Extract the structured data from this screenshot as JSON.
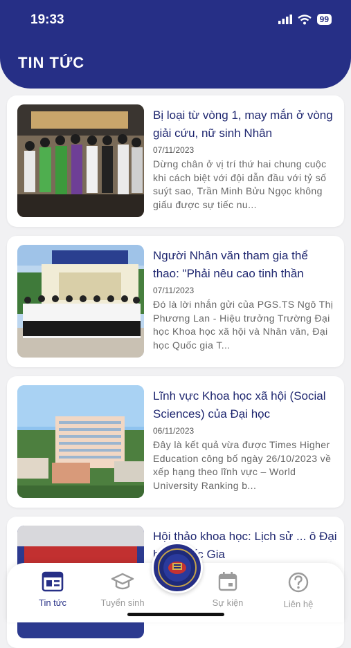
{
  "status_bar": {
    "time": "19:33",
    "battery": "99"
  },
  "header": {
    "title": "TIN TỨC"
  },
  "news": [
    {
      "title": "Bị loại từ vòng 1, may mắn ở vòng giải cứu, nữ sinh Nhân",
      "date": "07/11/2023",
      "excerpt": "Dừng chân ở vị trí thứ hai chung cuộc khi cách biệt với đội dẫn đầu với tỷ số suýt sao, Trần Minh Bửu Ngọc không giấu được sự tiếc nu..."
    },
    {
      "title": "Người Nhân văn tham gia thể thao: \"Phải nêu cao tinh thần",
      "date": "07/11/2023",
      "excerpt": "Đó là lời nhắn gửi của PGS.TS Ngô Thị Phương Lan - Hiệu trưởng Trường Đại học Khoa học xã hội và Nhân văn, Đại học Quốc gia T..."
    },
    {
      "title": "Lĩnh vực Khoa học xã hội (Social Sciences) của Đại học",
      "date": "06/11/2023",
      "excerpt": "Đây là kết quả vừa được Times Higher Education công bố ngày 26/10/2023 về xếp hạng theo lĩnh vực – World University Ranking b..."
    },
    {
      "title": "Hội thảo khoa học: Lịch sử ... ô Đại học Quốc Gia",
      "date": "",
      "excerpt": ""
    }
  ],
  "bottom_nav": {
    "items": [
      {
        "label": "Tin tức",
        "icon": "newspaper-icon",
        "active": true
      },
      {
        "label": "Tuyển sinh",
        "icon": "graduation-cap-icon"
      },
      {
        "label": "Sự kiện",
        "icon": "calendar-icon"
      },
      {
        "label": "Liên hệ",
        "icon": "help-circle-icon"
      }
    ]
  },
  "colors": {
    "primary": "#262f86",
    "title_text": "#1f2770",
    "background": "#f1f1f3"
  }
}
